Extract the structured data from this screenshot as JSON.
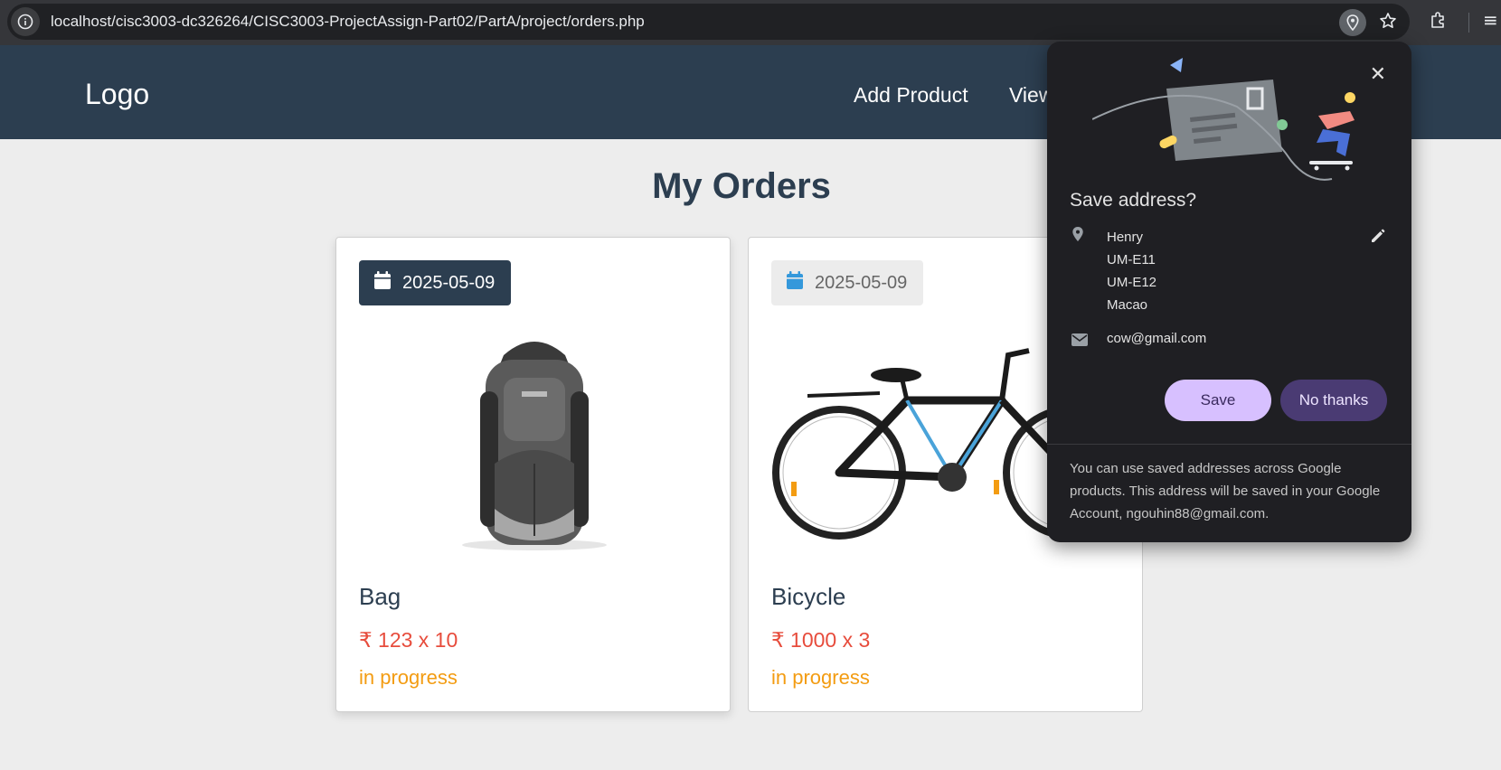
{
  "browser": {
    "url": "localhost/cisc3003-dc326264/CISC3003-ProjectAssign-Part02/PartA/project/orders.php"
  },
  "nav": {
    "logo": "Logo",
    "links": [
      "Add Product",
      "View"
    ]
  },
  "page": {
    "title": "My Orders"
  },
  "orders": [
    {
      "date": "2025-05-09",
      "name": "Bag",
      "price": "123 x 10",
      "status": "in progress"
    },
    {
      "date": "2025-05-09",
      "name": "Bicycle",
      "price": "1000 x 3",
      "status": "in progress"
    }
  ],
  "currency_symbol": "₹",
  "save_address_popup": {
    "title": "Save address?",
    "address_lines": [
      "Henry",
      "UM-E11",
      "UM-E12",
      "Macao"
    ],
    "email": "cow@gmail.com",
    "save_label": "Save",
    "no_thanks_label": "No thanks",
    "footer": "You can use saved addresses across Google products. This address will be saved in your Google Account, ngouhin88@gmail.com."
  },
  "colors": {
    "navbar": "#2c3e50",
    "price": "#e74c3c",
    "status": "#f39c12",
    "calendar_accent": "#3498db"
  }
}
